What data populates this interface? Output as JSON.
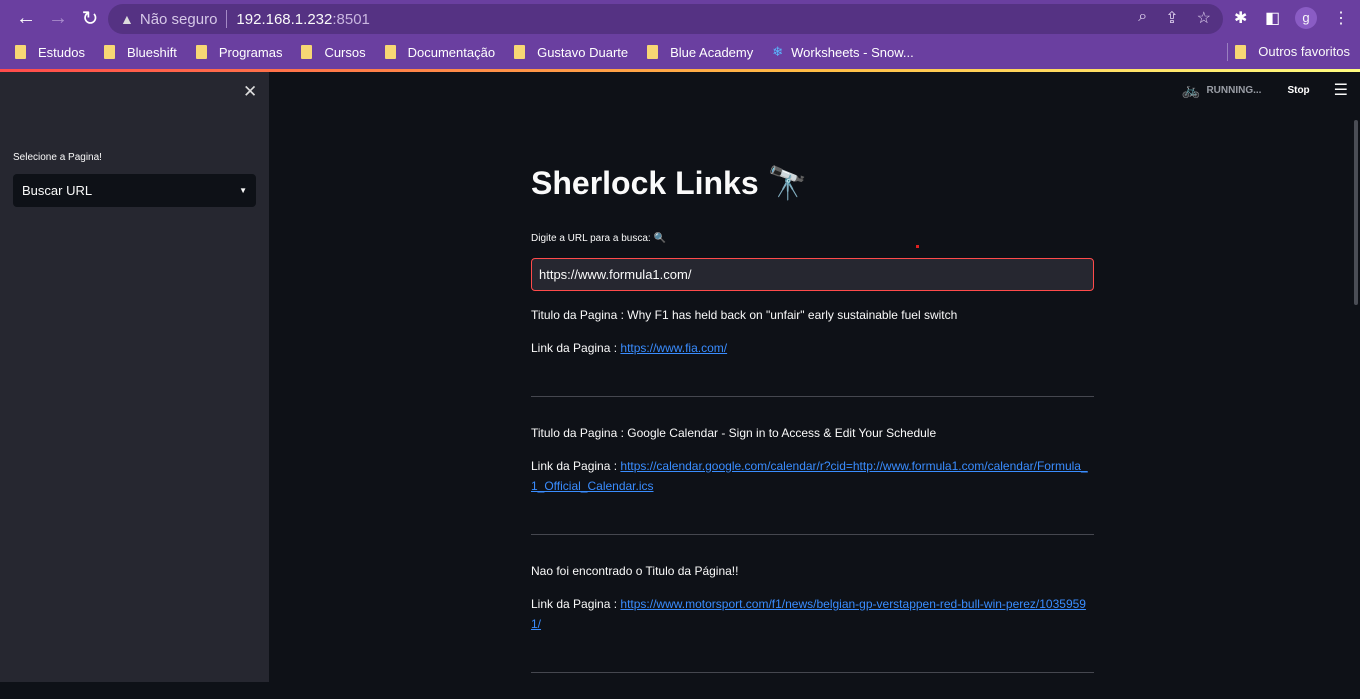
{
  "browser": {
    "not_secure": "Não seguro",
    "host": "192.168.1.232",
    "port": ":8501",
    "profile_initial": "g",
    "bookmarks": [
      "Estudos",
      "Blueshift",
      "Programas",
      "Cursos",
      "Documentação",
      "Gustavo Duarte",
      "Blue Academy",
      "Worksheets - Snow..."
    ],
    "other_bookmarks": "Outros favoritos"
  },
  "app_status": {
    "running": "RUNNING...",
    "stop": "Stop"
  },
  "sidebar": {
    "label": "Selecione a Pagina!",
    "selected": "Buscar URL"
  },
  "main": {
    "title": "Sherlock Links 🔭",
    "input_label": "Digite a URL para a busca: 🔍",
    "input_value": "https://www.formula1.com/",
    "results": [
      {
        "title": "Titulo da Pagina : Why F1 has held back on \"unfair\" early sustainable fuel switch",
        "link_label": "Link da Pagina : ",
        "link": "https://www.fia.com/"
      },
      {
        "title": "Titulo da Pagina : Google Calendar - Sign in to Access & Edit Your Schedule",
        "link_label": "Link da Pagina : ",
        "link": "https://calendar.google.com/calendar/r?cid=http://www.formula1.com/calendar/Formula_1_Official_Calendar.ics"
      },
      {
        "title": "Nao foi encontrado o Titulo da Página!!",
        "link_label": "Link da Pagina : ",
        "link": "https://www.motorsport.com/f1/news/belgian-gp-verstappen-red-bull-win-perez/10359591/"
      }
    ]
  }
}
